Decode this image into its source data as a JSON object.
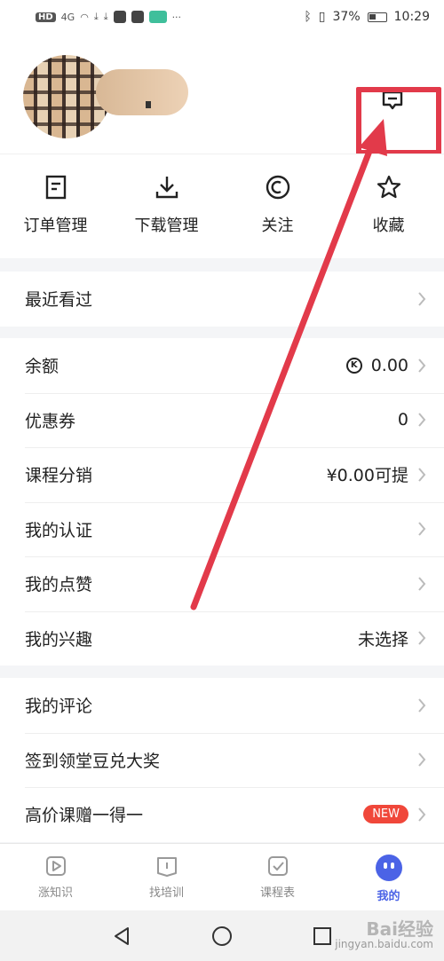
{
  "status_bar": {
    "network_badge": "HD",
    "signal": "4G",
    "battery": "37%",
    "time": "10:29",
    "more": "···"
  },
  "header": {
    "message_icon": "message-square-icon"
  },
  "quick_actions": [
    {
      "label": "订单管理",
      "icon": "order-icon"
    },
    {
      "label": "下载管理",
      "icon": "download-icon"
    },
    {
      "label": "关注",
      "icon": "eye-icon"
    },
    {
      "label": "收藏",
      "icon": "star-icon"
    }
  ],
  "section_recent": {
    "items": [
      {
        "label": "最近看过",
        "value": ""
      }
    ]
  },
  "section_account": {
    "items": [
      {
        "label": "余额",
        "value": "0.00"
      },
      {
        "label": "优惠券",
        "value": "0"
      },
      {
        "label": "课程分销",
        "value": "¥0.00可提"
      },
      {
        "label": "我的认证",
        "value": ""
      },
      {
        "label": "我的点赞",
        "value": ""
      },
      {
        "label": "我的兴趣",
        "value": "未选择"
      }
    ],
    "coin_symbol": "K"
  },
  "section_more": {
    "items": [
      {
        "label": "我的评论",
        "value": ""
      },
      {
        "label": "签到领堂豆兑大奖",
        "value": ""
      },
      {
        "label": "高价课赠一得一",
        "value": ""
      }
    ],
    "new_badge": "NEW"
  },
  "tabbar": {
    "tabs": [
      {
        "label": "涨知识",
        "icon": "play-square-icon"
      },
      {
        "label": "找培训",
        "icon": "book-icon"
      },
      {
        "label": "课程表",
        "icon": "checklist-icon"
      },
      {
        "label": "我的",
        "icon": "face-icon"
      }
    ],
    "active_index": 3
  },
  "watermark": {
    "title": "Bai经验",
    "url": "jingyan.baidu.com"
  },
  "colors": {
    "accent": "#4b63e6",
    "annotation": "#e23a4a",
    "badge": "#f0473a"
  }
}
